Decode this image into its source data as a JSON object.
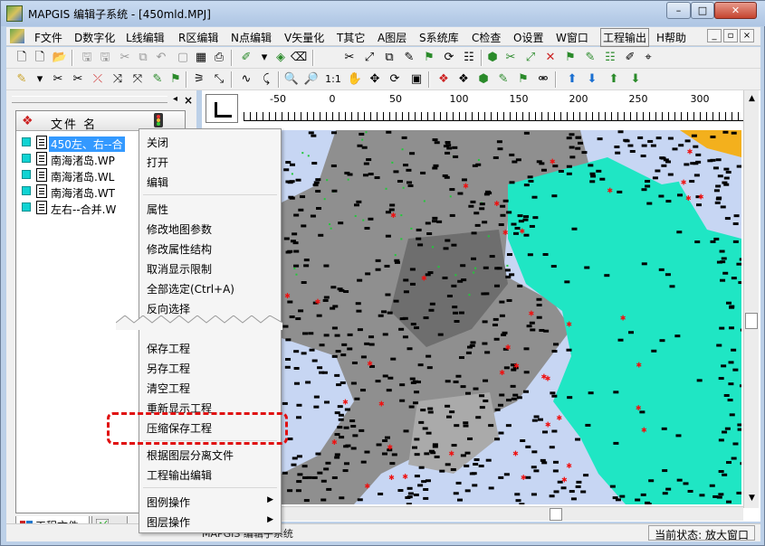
{
  "window": {
    "title": "MAPGIS 编辑子系统 - [450mld.MPJ]",
    "minimize": "–",
    "maximize": "□",
    "close": "✕"
  },
  "menubar": {
    "items": [
      "F文件",
      "D数字化",
      "L线编辑",
      "R区编辑",
      "N点编辑",
      "V矢量化",
      "T其它",
      "A图层",
      "S系统库",
      "C检查",
      "O设置",
      "W窗口",
      "工程输出",
      "H帮助"
    ],
    "mdi_controls": [
      "_",
      "▫",
      "×"
    ]
  },
  "left_panel": {
    "header_label": "文件 名",
    "files": [
      {
        "name": "450左、右--合",
        "selected": true
      },
      {
        "name": "南海渚岛.WP",
        "selected": false
      },
      {
        "name": "南海渚岛.WL",
        "selected": false
      },
      {
        "name": "南海渚岛.WT",
        "selected": false
      },
      {
        "name": "左右--合并.W",
        "selected": false
      }
    ],
    "tabs": [
      "工程文件",
      " "
    ]
  },
  "ruler": {
    "labels": [
      "-50",
      "0",
      "50",
      "100",
      "150",
      "200",
      "250",
      "300"
    ]
  },
  "context_menu": {
    "items": [
      {
        "label": "关闭"
      },
      {
        "label": "打开"
      },
      {
        "label": "编辑"
      },
      {
        "label": "属性"
      },
      {
        "label": "修改地图参数"
      },
      {
        "label": "修改属性结构"
      },
      {
        "label": "取消显示限制"
      },
      {
        "label": "全部选定(Ctrl+A)"
      },
      {
        "label": "反向选择"
      },
      {
        "label": "保存工程"
      },
      {
        "label": "另存工程"
      },
      {
        "label": "清空工程"
      },
      {
        "label": "重新显示工程"
      },
      {
        "label": "压缩保存工程"
      },
      {
        "label": "根据图层分离文件"
      },
      {
        "label": "工程输出编辑"
      },
      {
        "label": "图例操作",
        "submenu": true
      },
      {
        "label": "图层操作",
        "submenu": true
      }
    ]
  },
  "statusbar": {
    "app_text": "MAPGIS 编辑子系统",
    "state": "当前状态: 放大窗口"
  },
  "colors": {
    "sea": "#1fe6c4",
    "land_dark": "#8a8a8a",
    "land_light": "#c7d6f3",
    "highlight": "#e01010"
  }
}
